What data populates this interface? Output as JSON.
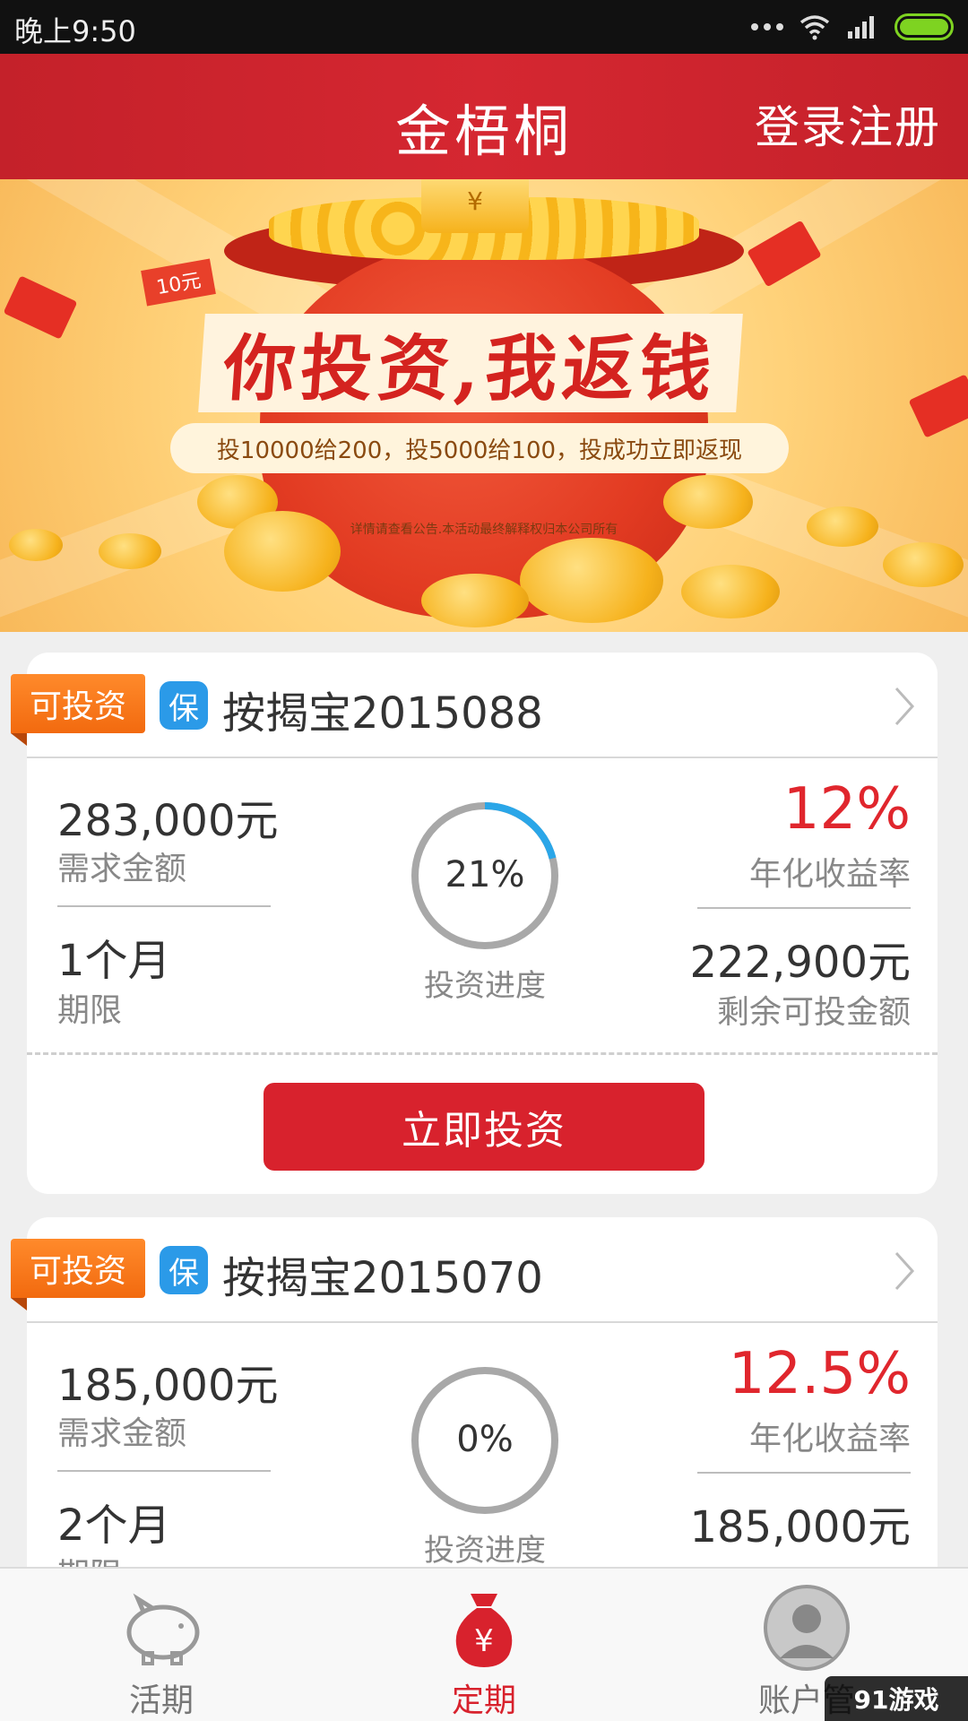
{
  "status_bar": {
    "time": "晚上9:50"
  },
  "header": {
    "title": "金梧桐",
    "login_register": "登录注册"
  },
  "banner": {
    "tag": "10元",
    "slogan": "你投资,我返钱",
    "offer": "投10000给200，投5000给100，投成功立即返现",
    "yuan_symbol": "¥",
    "fine_print": "详情请查看公告.本活动最终解释权归本公司所有"
  },
  "products": [
    {
      "badge": "可投资",
      "guarantee": "保",
      "name": "按揭宝2015088",
      "amount": "283,000元",
      "amount_label": "需求金额",
      "term": "1个月",
      "term_label": "期限",
      "progress_text": "21%",
      "progress": 0.21,
      "progress_label": "投资进度",
      "rate": "12%",
      "rate_label": "年化收益率",
      "remaining": "222,900元",
      "remaining_label": "剩余可投金额",
      "invest_button": "立即投资"
    },
    {
      "badge": "可投资",
      "guarantee": "保",
      "name": "按揭宝2015070",
      "amount": "185,000元",
      "amount_label": "需求金额",
      "term": "2个月",
      "term_label": "期限",
      "progress_text": "0%",
      "progress": 0,
      "progress_label": "投资进度",
      "rate": "12.5%",
      "rate_label": "年化收益率",
      "remaining": "185,000元"
    }
  ],
  "bottom_nav": [
    {
      "label": "活期",
      "icon": "piggy-bank-icon",
      "active": false
    },
    {
      "label": "定期",
      "icon": "money-bag-icon",
      "active": true
    },
    {
      "label": "账户管",
      "icon": "user-avatar-icon",
      "active": false
    }
  ],
  "watermark": "91游戏",
  "colors": {
    "brand_red": "#d8222d",
    "rate_red": "#e0262d",
    "badge_orange": "#f26a0f",
    "progress_blue": "#2aa6e8",
    "guarantee_blue": "#2b9ae8"
  }
}
